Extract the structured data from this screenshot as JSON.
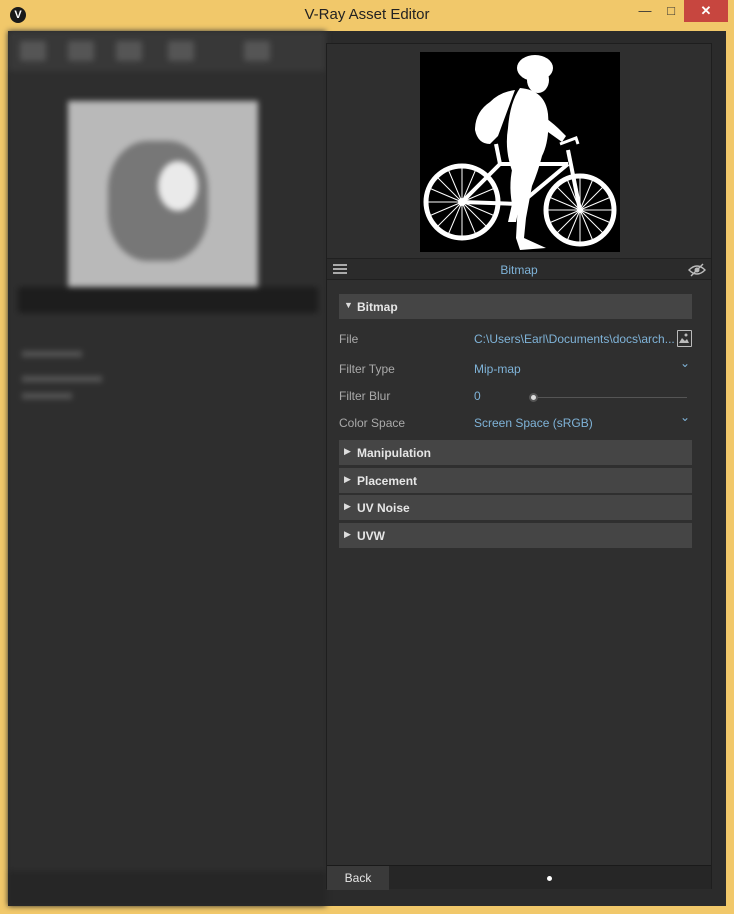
{
  "window": {
    "title": "V-Ray Asset Editor",
    "minimize_glyph": "—",
    "maximize_glyph": "□",
    "close_glyph": "✕",
    "app_icon": "vray-logo-icon",
    "app_icon_glyph": "V"
  },
  "panel": {
    "header_label": "Bitmap",
    "list_icon": "list-icon",
    "visibility_icon": "eye-hidden-icon",
    "thumbnail": "bitmap-preview-cyclist-silhouette",
    "expanded_section": {
      "label": "Bitmap",
      "arrow": "▼",
      "properties": {
        "file_label": "File",
        "file_value": "C:\\Users\\Earl\\Documents\\docs\\arch...",
        "filter_type_label": "Filter Type",
        "filter_type_value": "Mip-map",
        "filter_blur_label": "Filter Blur",
        "filter_blur_value": "0",
        "color_space_label": "Color Space",
        "color_space_value": "Screen Space (sRGB)"
      }
    },
    "collapsed_sections": [
      {
        "label": "Manipulation",
        "arrow": "▶"
      },
      {
        "label": "Placement",
        "arrow": "▶"
      },
      {
        "label": "UV Noise",
        "arrow": "▶"
      },
      {
        "label": "UVW",
        "arrow": "▶"
      }
    ],
    "chevron_glyph": "⌄",
    "footer": {
      "back_label": "Back"
    }
  },
  "colors": {
    "accent": "#7fb3d8",
    "window_border": "#f1c86a",
    "close_button": "#c7463f",
    "panel_bg": "#2f2f2f",
    "section_bg": "#454545"
  }
}
